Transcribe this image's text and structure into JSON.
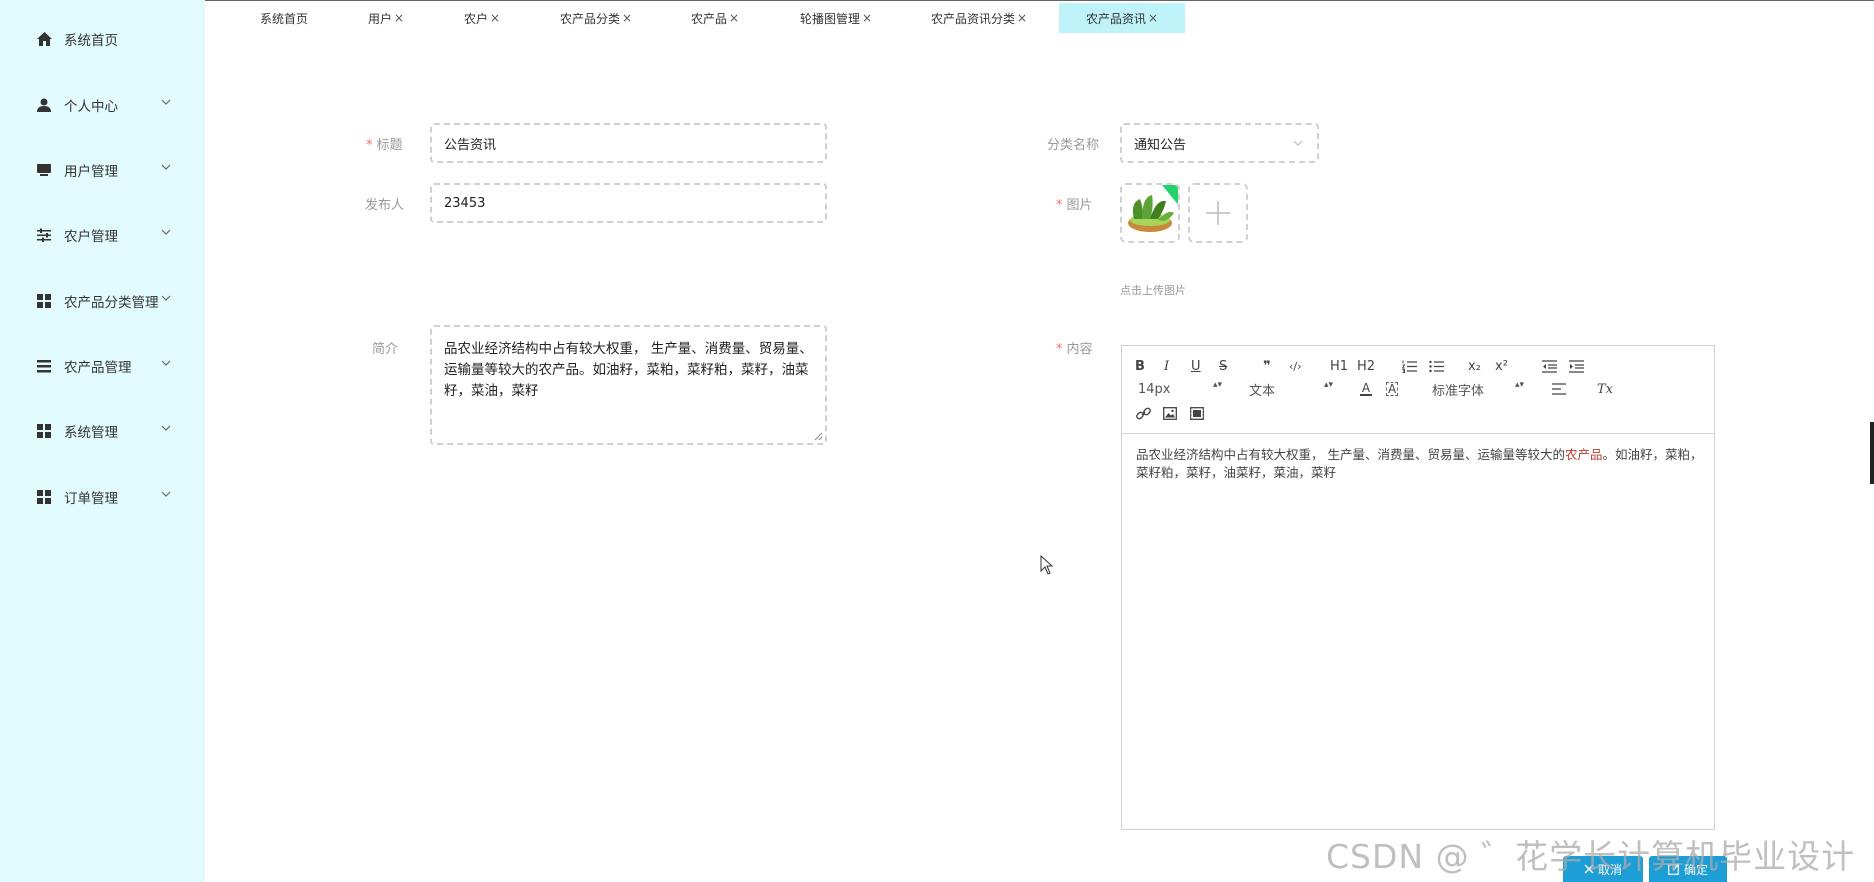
{
  "sidebar": {
    "items": [
      {
        "label": "系统首页",
        "icon": "home-icon",
        "has_children": false
      },
      {
        "label": "个人中心",
        "icon": "user-icon",
        "has_children": true
      },
      {
        "label": "用户管理",
        "icon": "monitor-icon",
        "has_children": true
      },
      {
        "label": "农户管理",
        "icon": "sliders-icon",
        "has_children": true
      },
      {
        "label": "农产品分类管理",
        "icon": "grid-icon",
        "has_children": true
      },
      {
        "label": "农产品管理",
        "icon": "list-icon",
        "has_children": true
      },
      {
        "label": "系统管理",
        "icon": "grid-icon",
        "has_children": true
      },
      {
        "label": "订单管理",
        "icon": "grid-icon",
        "has_children": true
      }
    ]
  },
  "tabs": [
    {
      "label": "系统首页",
      "closable": false,
      "active": false
    },
    {
      "label": "用户",
      "closable": true,
      "active": false
    },
    {
      "label": "农户",
      "closable": true,
      "active": false
    },
    {
      "label": "农产品分类",
      "closable": true,
      "active": false
    },
    {
      "label": "农产品",
      "closable": true,
      "active": false
    },
    {
      "label": "轮播图管理",
      "closable": true,
      "active": false
    },
    {
      "label": "农产品资讯分类",
      "closable": true,
      "active": false
    },
    {
      "label": "农产品资讯",
      "closable": true,
      "active": true
    }
  ],
  "tab_close_glyph": "×",
  "form": {
    "title": {
      "label": "标题",
      "required": true,
      "value": "公告资讯"
    },
    "category": {
      "label": "分类名称",
      "required": false,
      "value": "通知公告"
    },
    "publisher": {
      "label": "发布人",
      "required": false,
      "value": "23453"
    },
    "image": {
      "label": "图片",
      "required": true,
      "hint": "点击上传图片"
    },
    "summary": {
      "label": "简介",
      "required": false,
      "value": "品农业经济结构中占有较大权重， 生产量、消费量、贸易量、运输量等较大的农产品。如油籽，菜粕，菜籽粕，菜籽，油菜籽，菜油，菜籽"
    },
    "content": {
      "label": "内容",
      "required": true,
      "body_before": "品农业经济结构中占有较大权重， 生产量、消费量、贸易量、运输量等较大的",
      "body_highlight": "农产品",
      "body_after": "。如油籽，菜粕，菜籽粕，菜籽，油菜籽，菜油，菜籽"
    },
    "required_mark": "*"
  },
  "editor_toolbar": {
    "bold": "B",
    "italic": "I",
    "underline": "U",
    "strike": "S",
    "quote": "❞",
    "code": "‹/›",
    "h1": "H1",
    "h2": "H2",
    "sub": "x₂",
    "sup": "x²",
    "size_value": "14px",
    "header_value": "文本",
    "font_value": "标准字体",
    "color_letter": "A",
    "bg_letter": "A",
    "clean": "Tx",
    "select_arrow": "▴▾"
  },
  "buttons": {
    "cancel": "取消",
    "confirm": "确定"
  },
  "watermark": "CSDN @ ゛花学长计算机毕业设计",
  "colors": {
    "sidebar_bg": "#e2fcfd",
    "active_tab": "#bff3fa",
    "primary": "#1e9ed6",
    "required": "#f56c6c"
  }
}
